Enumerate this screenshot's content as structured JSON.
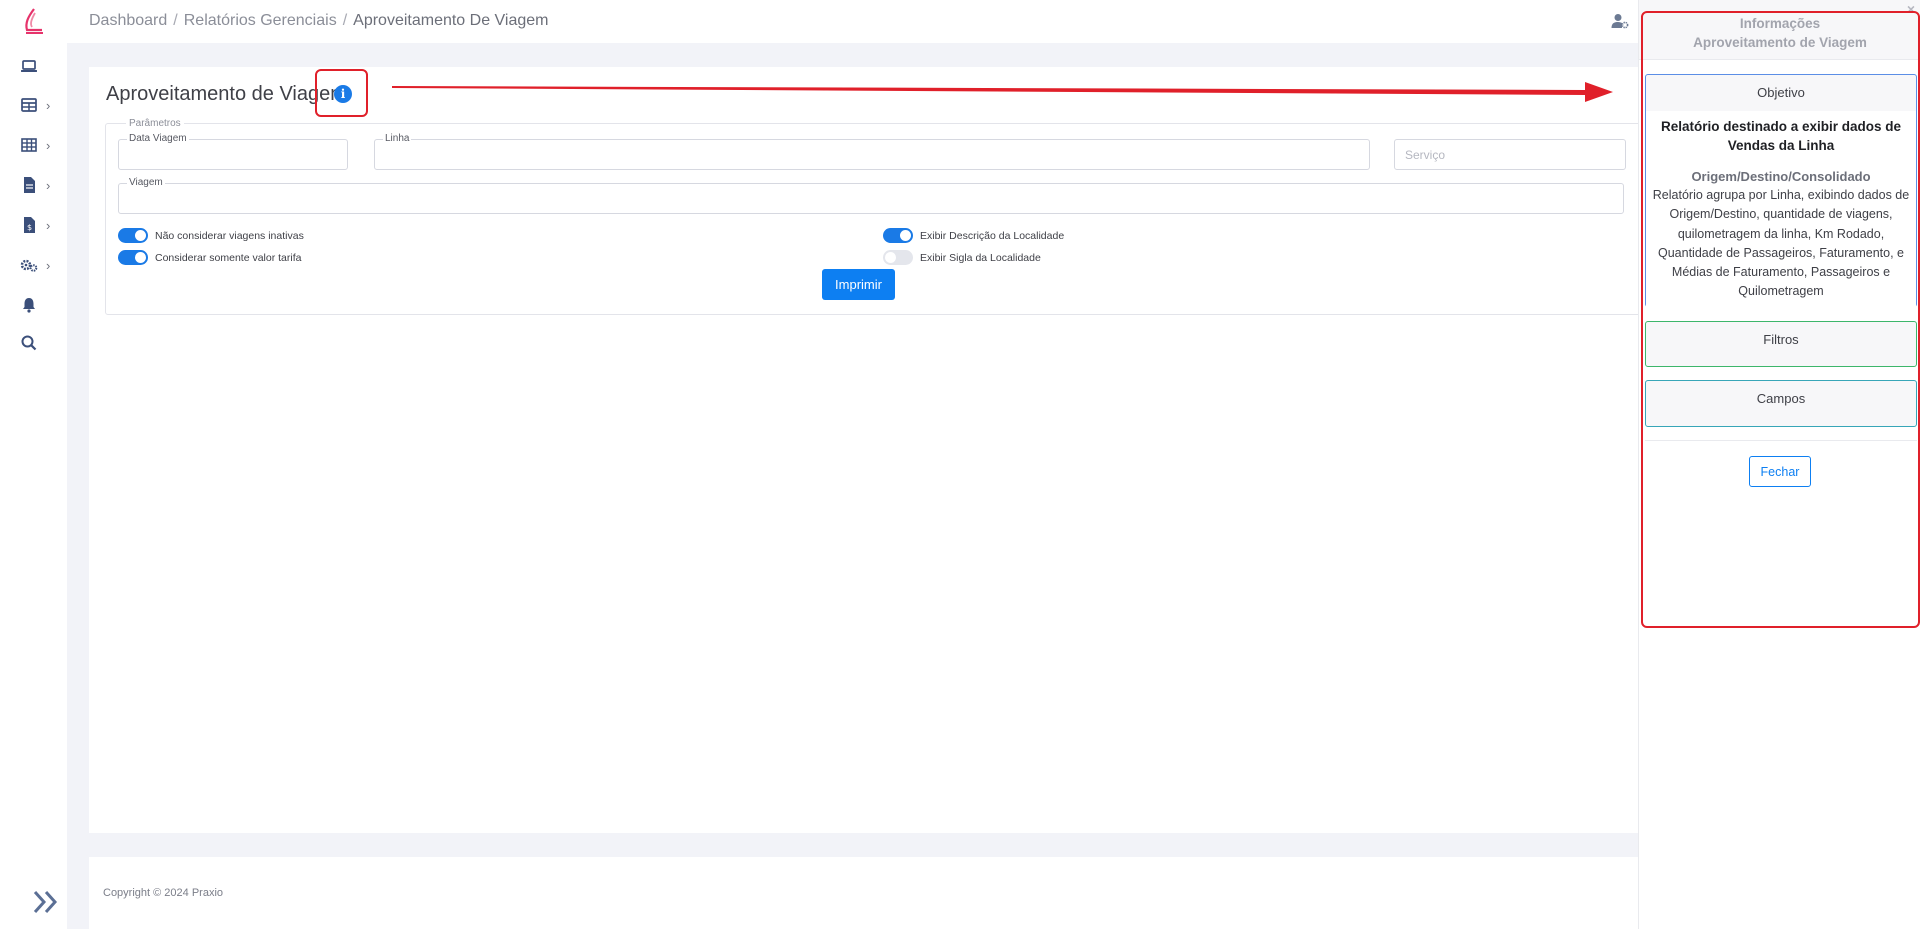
{
  "breadcrumb": {
    "items": [
      "Dashboard",
      "Relatórios Gerenciais",
      "Aproveitamento De Viagem"
    ],
    "separator": "/"
  },
  "sidebar": {
    "icons": [
      "laptop-icon",
      "table-icon",
      "grid-icon",
      "file-icon",
      "invoice-icon",
      "gears-icon",
      "bell-icon",
      "search-icon"
    ]
  },
  "main": {
    "title": "Aproveitamento de Viagem",
    "info_icon": "i",
    "params_legend": "Parâmetros",
    "fields": {
      "data_viagem_label": "Data Viagem",
      "data_viagem_value": "",
      "linha_label": "Linha",
      "linha_value": "",
      "servico_placeholder": "Serviço",
      "viagem_label": "Viagem",
      "viagem_value": ""
    },
    "toggles": {
      "nao_considerar": {
        "label": "Não considerar viagens inativas",
        "on": true
      },
      "considerar_tarifa": {
        "label": "Considerar somente valor tarifa",
        "on": true
      },
      "exibir_descricao": {
        "label": "Exibir Descrição da Localidade",
        "on": true
      },
      "exibir_sigla": {
        "label": "Exibir Sigla da Localidade",
        "on": false
      }
    },
    "print_label": "Imprimir"
  },
  "footer": {
    "copyright": "Copyright © 2024 Praxio"
  },
  "info_panel": {
    "title_line1": "Informações",
    "title_line2": "Aproveitamento de Viagem",
    "close_x": "×",
    "objetivo": {
      "header": "Objetivo",
      "lead": "Relatório destinado a exibir dados de Vendas da Linha",
      "subtitle": "Origem/Destino/Consolidado",
      "description": "Relatório agrupa por Linha, exibindo dados de Origem/Destino, quantidade de viagens, quilometragem da linha, Km Rodado, Quantidade de Passageiros, Faturamento, e Médias de Faturamento, Passageiros e Quilometragem"
    },
    "filtros_header": "Filtros",
    "campos_header": "Campos",
    "close_button": "Fechar"
  },
  "colors": {
    "accent": "#0d7ff2",
    "annotation": "#e0202a",
    "filtros_border": "#3db66b",
    "campos_border": "#38a6b8",
    "objetivo_border": "#5b8ee6"
  }
}
